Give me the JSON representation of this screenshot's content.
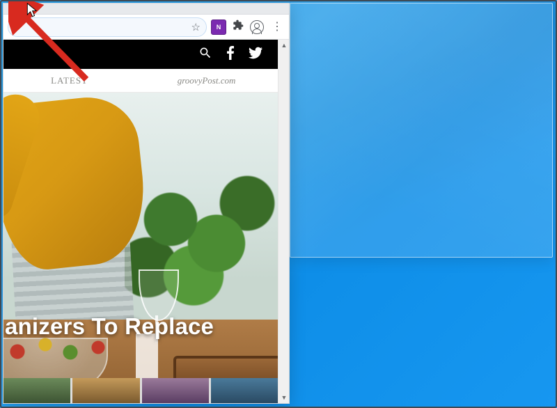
{
  "colors": {
    "arrow": "#d82a1f",
    "desktop": "#1797f0",
    "ext_badge_bg": "#7b2ab0"
  },
  "browser": {
    "omnibox_value": "",
    "star_icon": "star-icon",
    "extension_label": "N",
    "extensions_icon": "puzzle-icon",
    "profile_icon": "profile-icon",
    "menu_icon": "kebab-menu-icon"
  },
  "page": {
    "blackbar": {
      "search_icon": "search-icon",
      "facebook_icon": "facebook-icon",
      "twitter_icon": "twitter-icon"
    },
    "subnav": {
      "tab_latest": "LATEST",
      "brand": "groovyPost.com"
    },
    "hero": {
      "headline_fragment": "anizers To Replace"
    }
  },
  "annotation": {
    "arrow": "red-arrow-annotation",
    "cursor": "mouse-cursor"
  },
  "snap_preview": "aero-snap-preview"
}
